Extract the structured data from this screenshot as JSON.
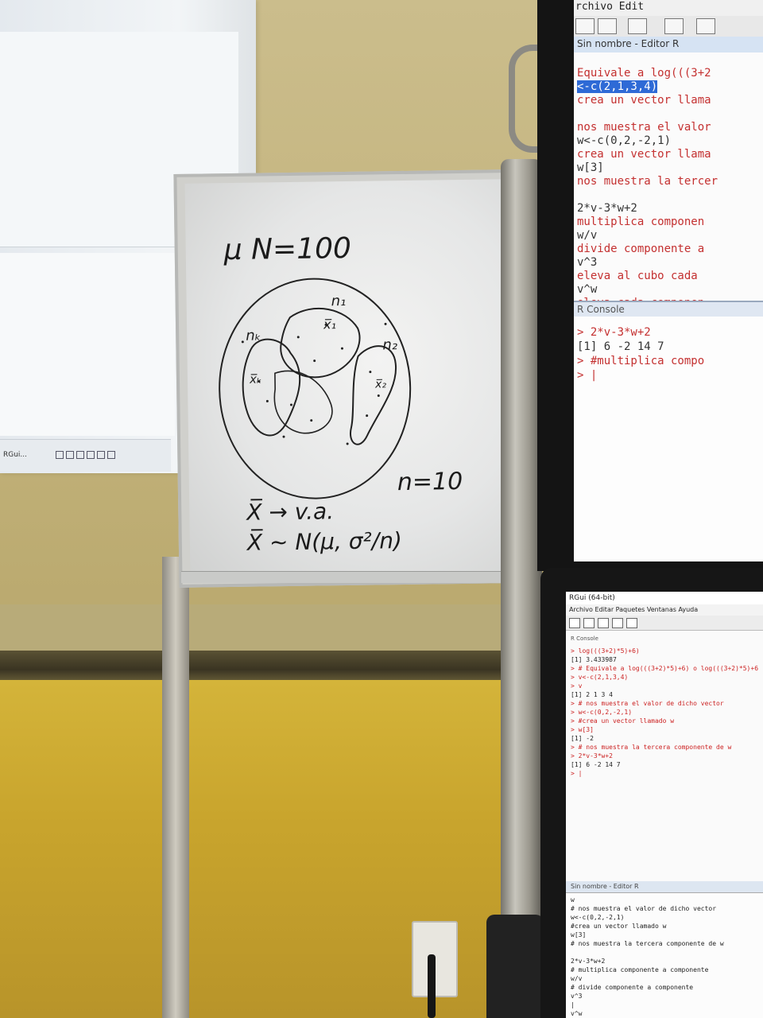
{
  "projection": {
    "taskbar_app": "RGui...",
    "taskbar_tray": "^ \u0006 ▭ ▭ ) ☰"
  },
  "whiteboard": {
    "line1": "µ N=100",
    "sample_label": "n=10",
    "n1": "n₁",
    "n2": "n₂",
    "nk": "nₖ",
    "x1": "x̅₁",
    "x2": "x̅₂",
    "xk": "x̅ₖ",
    "formula1": "X̅ → v.a.",
    "formula2": "X̅ ~ N(µ, σ²/n)"
  },
  "monitor_large": {
    "menu": "rchivo   Edit",
    "editor_title": "Sin nombre - Editor R",
    "lines": [
      {
        "text": "Equivale a log(((3+2",
        "cls": "red"
      },
      {
        "text": "<-c(2,1,3,4)",
        "cls": "sel"
      },
      {
        "text": "crea un vector llama",
        "cls": "red"
      },
      {
        "text": "",
        "cls": ""
      },
      {
        "text": "nos muestra el valor",
        "cls": "red"
      },
      {
        "text": "w<-c(0,2,-2,1)",
        "cls": ""
      },
      {
        "text": "crea un vector llama",
        "cls": "red"
      },
      {
        "text": "w[3]",
        "cls": ""
      },
      {
        "text": "nos muestra la tercer",
        "cls": "red"
      },
      {
        "text": "",
        "cls": ""
      },
      {
        "text": "2*v-3*w+2",
        "cls": ""
      },
      {
        "text": "multiplica componen",
        "cls": "red"
      },
      {
        "text": "w/v",
        "cls": ""
      },
      {
        "text": "divide componente a",
        "cls": "red"
      },
      {
        "text": "v^3",
        "cls": ""
      },
      {
        "text": "eleva al cubo cada",
        "cls": "red"
      },
      {
        "text": "v^w",
        "cls": ""
      },
      {
        "text": "eleva cada componen",
        "cls": "red"
      }
    ],
    "console_title": "R Console",
    "console_lines": [
      {
        "text": "> 2*v-3*w+2",
        "cls": "red"
      },
      {
        "text": "[1]  6 -2 14  7",
        "cls": ""
      },
      {
        "text": "> #multiplica compo",
        "cls": "red"
      },
      {
        "text": "> |",
        "cls": "red"
      }
    ]
  },
  "monitor_small": {
    "title": "RGui (64-bit)",
    "menu": "Archivo  Editar  Paquetes  Ventanas  Ayuda",
    "console_title": "R Console",
    "console_lines": [
      {
        "text": "> log(((3+2)*5)+6)",
        "cls": "red"
      },
      {
        "text": "[1] 3.433987",
        "cls": ""
      },
      {
        "text": "> # Equivale a log(((3+2)*5)+6) o log(((3+2)*5)+6",
        "cls": "red"
      },
      {
        "text": "> v<-c(2,1,3,4)",
        "cls": "red"
      },
      {
        "text": "> v",
        "cls": "red"
      },
      {
        "text": "[1] 2 1 3 4",
        "cls": ""
      },
      {
        "text": "> # nos muestra el valor de dicho vector",
        "cls": "red"
      },
      {
        "text": "> w<-c(0,2,-2,1)",
        "cls": "red"
      },
      {
        "text": "> #crea un vector llamado w",
        "cls": "red"
      },
      {
        "text": "> w[3]",
        "cls": "red"
      },
      {
        "text": "[1] -2",
        "cls": ""
      },
      {
        "text": "> # nos muestra la tercera componente de w",
        "cls": "red"
      },
      {
        "text": "> 2*v-3*w+2",
        "cls": "red"
      },
      {
        "text": "[1]  6 -2 14  7",
        "cls": ""
      },
      {
        "text": "> |",
        "cls": "red"
      }
    ],
    "editor_title": "Sin nombre - Editor R",
    "editor_lines": [
      {
        "text": "w",
        "cls": ""
      },
      {
        "text": "# nos muestra el valor de dicho vector",
        "cls": ""
      },
      {
        "text": "w<-c(0,2,-2,1)",
        "cls": ""
      },
      {
        "text": "#crea un vector llamado w",
        "cls": ""
      },
      {
        "text": "w[3]",
        "cls": ""
      },
      {
        "text": "# nos muestra la tercera componente de w",
        "cls": ""
      },
      {
        "text": "",
        "cls": ""
      },
      {
        "text": "2*v-3*w+2",
        "cls": ""
      },
      {
        "text": "# multiplica componente a componente",
        "cls": ""
      },
      {
        "text": "w/v",
        "cls": ""
      },
      {
        "text": "# divide componente a componente",
        "cls": ""
      },
      {
        "text": "v^3",
        "cls": ""
      },
      {
        "text": "|",
        "cls": ""
      },
      {
        "text": "v^w",
        "cls": ""
      }
    ]
  }
}
